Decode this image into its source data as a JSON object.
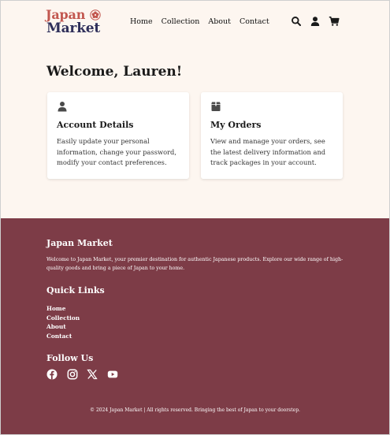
{
  "header": {
    "logo_line1": "Japan",
    "logo_line2": "Market",
    "nav": [
      {
        "label": "Home"
      },
      {
        "label": "Collection"
      },
      {
        "label": "About"
      },
      {
        "label": "Contact"
      }
    ],
    "icons": [
      "search-icon",
      "user-icon",
      "cart-icon"
    ]
  },
  "main": {
    "welcome": "Welcome, Lauren!",
    "cards": [
      {
        "icon": "user-icon",
        "title": "Account Details",
        "description": "Easily update your personal information, change your password, modify your contact preferences."
      },
      {
        "icon": "box-icon",
        "title": "My Orders",
        "description": "View and manage your orders, see the latest delivery information and track packages in your account."
      }
    ]
  },
  "footer": {
    "brand": "Japan Market",
    "about_text": "Welcome to Japan Market, your premier destination for authentic Japanese products. Explore our wide range of high-quality goods and bring a piece of Japan to your home.",
    "quick_links_title": "Quick Links",
    "quick_links": [
      {
        "label": "Home"
      },
      {
        "label": "Collection"
      },
      {
        "label": "About"
      },
      {
        "label": "Contact"
      }
    ],
    "follow_title": "Follow Us",
    "social_icons": [
      "facebook-icon",
      "instagram-icon",
      "x-icon",
      "youtube-icon"
    ],
    "copyright": "© 2024 Japan Market | All rights reserved. Bringing the best of Japan to your doorstep."
  },
  "colors": {
    "page_bg": "#fdf6f0",
    "footer_bg": "#7d3c47",
    "logo_red": "#c2574f",
    "logo_navy": "#2f2f5a",
    "icon_gray": "#4a4a4a"
  }
}
